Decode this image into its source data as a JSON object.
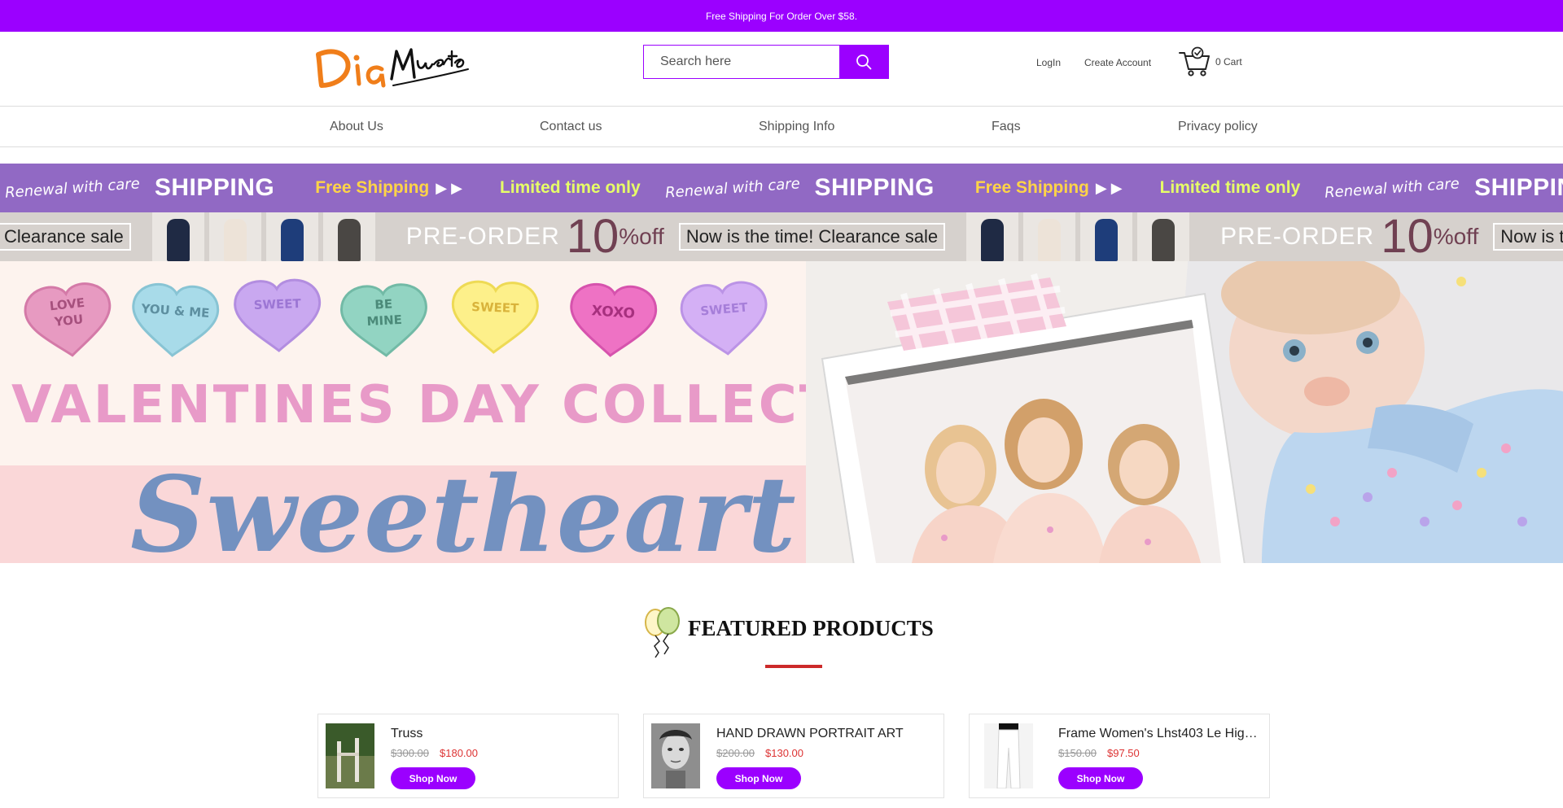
{
  "announcement": {
    "text": "Free Shipping For Order Over $58."
  },
  "header": {
    "logo_text": "Dia Muertos",
    "search": {
      "placeholder": "Search here"
    },
    "login_label": "LogIn",
    "create_account_label": "Create Account",
    "cart_label": "0 Cart"
  },
  "nav": {
    "items": [
      {
        "label": "About Us"
      },
      {
        "label": "Contact us"
      },
      {
        "label": "Shipping Info"
      },
      {
        "label": "Faqs"
      },
      {
        "label": "Privacy policy"
      }
    ]
  },
  "promo_banner_1": {
    "renewal": "Renewal with care",
    "shipping": "SHIPPING",
    "free_shipping": "Free Shipping",
    "limited": "Limited time only"
  },
  "promo_banner_2": {
    "clearance_short": "Clearance sale",
    "pre_order": "PRE-ORDER",
    "discount_number": "10",
    "discount_unit": "%off",
    "clearance_full": "Now is the time! Clearance sale"
  },
  "hero": {
    "hearts": [
      "LOVE YOU",
      "YOU & ME",
      "SWEET",
      "BE MINE",
      "SWEET",
      "XOXO",
      "SWEET"
    ],
    "title": "VALENTINES DAY COLLECTION",
    "script_text": "Sweetheart"
  },
  "featured": {
    "title": "FEATURED PRODUCTS"
  },
  "products": [
    {
      "name": "Truss",
      "old_price": "$300.00",
      "new_price": "$180.00",
      "button": "Shop Now"
    },
    {
      "name": "HAND DRAWN PORTRAIT ART",
      "old_price": "$200.00",
      "new_price": "$130.00",
      "button": "Shop Now"
    },
    {
      "name": "Frame Women's Lhst403 Le Hig…",
      "old_price": "$150.00",
      "new_price": "$97.50",
      "button": "Shop Now"
    }
  ],
  "colors": {
    "brand_purple": "#9b00ff",
    "promo_purple": "#9169c4",
    "accent_red": "#cc2a2a",
    "price_red": "#dd3333"
  }
}
